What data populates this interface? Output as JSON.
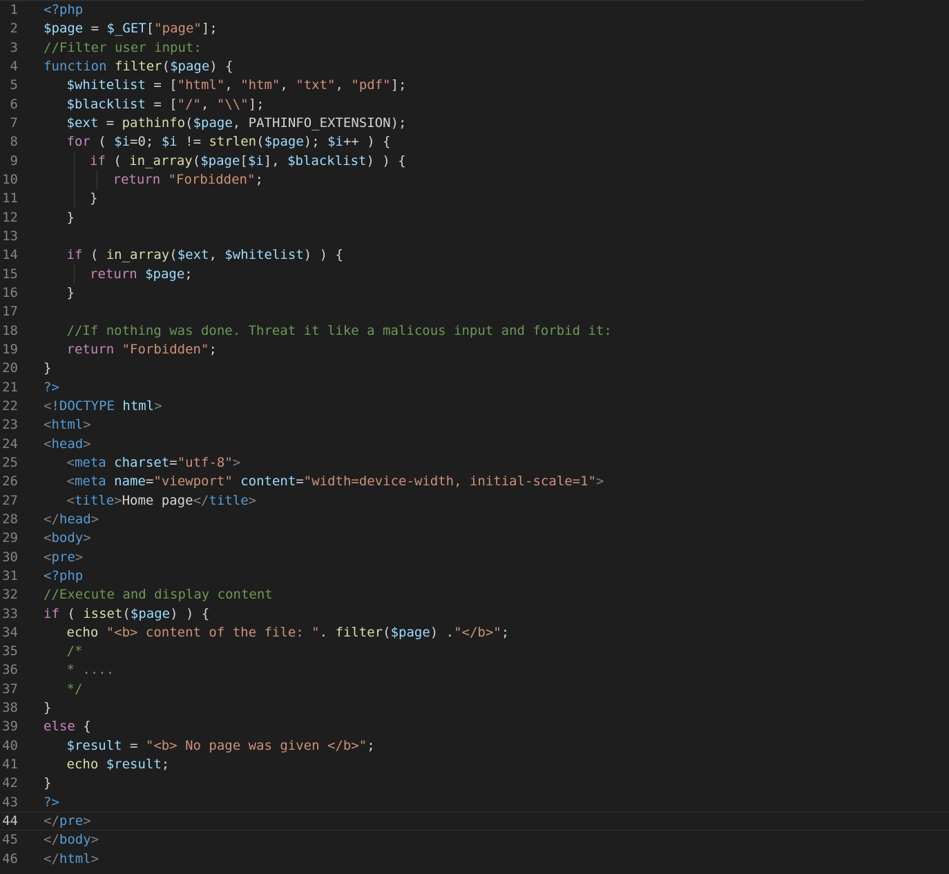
{
  "editor": {
    "theme_colors": {
      "background": "#1e1e1e",
      "keyword": "#569cd6",
      "control": "#c586c0",
      "variable": "#9cdcfe",
      "function": "#dcdcaa",
      "string": "#ce9178",
      "comment": "#6a9955",
      "tag_bracket": "#808080",
      "line_number": "#858585"
    },
    "current_line": 44,
    "lines": [
      {
        "n": "1",
        "indent": 0,
        "tokens": [
          [
            "t-kw",
            "<?php"
          ]
        ]
      },
      {
        "n": "2",
        "indent": 0,
        "tokens": [
          [
            "t-var",
            "$page"
          ],
          [
            "t-pun",
            " = "
          ],
          [
            "t-var",
            "$_GET"
          ],
          [
            "t-pun",
            "["
          ],
          [
            "t-str",
            "\"page\""
          ],
          [
            "t-pun",
            "];"
          ]
        ]
      },
      {
        "n": "3",
        "indent": 0,
        "tokens": [
          [
            "t-com",
            "//Filter user input:"
          ]
        ]
      },
      {
        "n": "4",
        "indent": 0,
        "tokens": [
          [
            "t-kw",
            "function"
          ],
          [
            "t-pun",
            " "
          ],
          [
            "t-fn",
            "filter"
          ],
          [
            "t-pun",
            "("
          ],
          [
            "t-var",
            "$page"
          ],
          [
            "t-pun",
            ") {"
          ]
        ]
      },
      {
        "n": "5",
        "indent": 1,
        "tokens": [
          [
            "t-var",
            "$whitelist"
          ],
          [
            "t-pun",
            " = ["
          ],
          [
            "t-str",
            "\"html\""
          ],
          [
            "t-pun",
            ", "
          ],
          [
            "t-str",
            "\"htm\""
          ],
          [
            "t-pun",
            ", "
          ],
          [
            "t-str",
            "\"txt\""
          ],
          [
            "t-pun",
            ", "
          ],
          [
            "t-str",
            "\"pdf\""
          ],
          [
            "t-pun",
            "];"
          ]
        ]
      },
      {
        "n": "6",
        "indent": 1,
        "tokens": [
          [
            "t-var",
            "$blacklist"
          ],
          [
            "t-pun",
            " = ["
          ],
          [
            "t-str",
            "\"/\""
          ],
          [
            "t-pun",
            ", "
          ],
          [
            "t-str",
            "\"\\\\\""
          ],
          [
            "t-pun",
            "];"
          ]
        ]
      },
      {
        "n": "7",
        "indent": 1,
        "tokens": [
          [
            "t-var",
            "$ext"
          ],
          [
            "t-pun",
            " = "
          ],
          [
            "t-fn",
            "pathinfo"
          ],
          [
            "t-pun",
            "("
          ],
          [
            "t-var",
            "$page"
          ],
          [
            "t-pun",
            ", "
          ],
          [
            "t-const",
            "PATHINFO_EXTENSION"
          ],
          [
            "t-pun",
            ");"
          ]
        ]
      },
      {
        "n": "8",
        "indent": 1,
        "tokens": [
          [
            "t-ctl",
            "for"
          ],
          [
            "t-pun",
            " ( "
          ],
          [
            "t-var",
            "$i"
          ],
          [
            "t-pun",
            "=0; "
          ],
          [
            "t-var",
            "$i"
          ],
          [
            "t-pun",
            " != "
          ],
          [
            "t-fn",
            "strlen"
          ],
          [
            "t-pun",
            "("
          ],
          [
            "t-var",
            "$page"
          ],
          [
            "t-pun",
            "); "
          ],
          [
            "t-var",
            "$i"
          ],
          [
            "t-pun",
            "++ ) {"
          ]
        ]
      },
      {
        "n": "9",
        "indent": 2,
        "tokens": [
          [
            "t-ctl",
            "if"
          ],
          [
            "t-pun",
            " ( "
          ],
          [
            "t-fn",
            "in_array"
          ],
          [
            "t-pun",
            "("
          ],
          [
            "t-var",
            "$page"
          ],
          [
            "t-pun",
            "["
          ],
          [
            "t-var",
            "$i"
          ],
          [
            "t-pun",
            "], "
          ],
          [
            "t-var",
            "$blacklist"
          ],
          [
            "t-pun",
            ") ) {"
          ]
        ]
      },
      {
        "n": "10",
        "indent": 3,
        "tokens": [
          [
            "t-ctl",
            "return"
          ],
          [
            "t-pun",
            " "
          ],
          [
            "t-str",
            "\"Forbidden\""
          ],
          [
            "t-pun",
            ";"
          ]
        ]
      },
      {
        "n": "11",
        "indent": 2,
        "tokens": [
          [
            "t-pun",
            "}"
          ]
        ]
      },
      {
        "n": "12",
        "indent": 1,
        "tokens": [
          [
            "t-pun",
            "}"
          ]
        ]
      },
      {
        "n": "13",
        "indent": 1,
        "tokens": []
      },
      {
        "n": "14",
        "indent": 1,
        "tokens": [
          [
            "t-ctl",
            "if"
          ],
          [
            "t-pun",
            " ( "
          ],
          [
            "t-fn",
            "in_array"
          ],
          [
            "t-pun",
            "("
          ],
          [
            "t-var",
            "$ext"
          ],
          [
            "t-pun",
            ", "
          ],
          [
            "t-var",
            "$whitelist"
          ],
          [
            "t-pun",
            ") ) {"
          ]
        ]
      },
      {
        "n": "15",
        "indent": 2,
        "tokens": [
          [
            "t-ctl",
            "return"
          ],
          [
            "t-pun",
            " "
          ],
          [
            "t-var",
            "$page"
          ],
          [
            "t-pun",
            ";"
          ]
        ]
      },
      {
        "n": "16",
        "indent": 1,
        "tokens": [
          [
            "t-pun",
            "}"
          ]
        ]
      },
      {
        "n": "17",
        "indent": 1,
        "tokens": []
      },
      {
        "n": "18",
        "indent": 1,
        "tokens": [
          [
            "t-com",
            "//If nothing was done. Threat it like a malicous input and forbid it:"
          ]
        ]
      },
      {
        "n": "19",
        "indent": 1,
        "tokens": [
          [
            "t-ctl",
            "return"
          ],
          [
            "t-pun",
            " "
          ],
          [
            "t-str",
            "\"Forbidden\""
          ],
          [
            "t-pun",
            ";"
          ]
        ]
      },
      {
        "n": "20",
        "indent": 0,
        "tokens": [
          [
            "t-pun",
            "}"
          ]
        ]
      },
      {
        "n": "21",
        "indent": 0,
        "tokens": [
          [
            "t-kw",
            "?>"
          ]
        ]
      },
      {
        "n": "22",
        "indent": 0,
        "tokens": [
          [
            "t-br",
            "<"
          ],
          [
            "t-tag",
            "!DOCTYPE"
          ],
          [
            "t-pun",
            " "
          ],
          [
            "t-attr",
            "html"
          ],
          [
            "t-br",
            ">"
          ]
        ]
      },
      {
        "n": "23",
        "indent": 0,
        "tokens": [
          [
            "t-br",
            "<"
          ],
          [
            "t-tag",
            "html"
          ],
          [
            "t-br",
            ">"
          ]
        ]
      },
      {
        "n": "24",
        "indent": 0,
        "tokens": [
          [
            "t-br",
            "<"
          ],
          [
            "t-tag",
            "head"
          ],
          [
            "t-br",
            ">"
          ]
        ]
      },
      {
        "n": "25",
        "indent": 1,
        "tokens": [
          [
            "t-br",
            "<"
          ],
          [
            "t-tag",
            "meta"
          ],
          [
            "t-pun",
            " "
          ],
          [
            "t-attr",
            "charset"
          ],
          [
            "t-pun",
            "="
          ],
          [
            "t-str",
            "\"utf-8\""
          ],
          [
            "t-br",
            ">"
          ]
        ]
      },
      {
        "n": "26",
        "indent": 1,
        "tokens": [
          [
            "t-br",
            "<"
          ],
          [
            "t-tag",
            "meta"
          ],
          [
            "t-pun",
            " "
          ],
          [
            "t-attr",
            "name"
          ],
          [
            "t-pun",
            "="
          ],
          [
            "t-str",
            "\"viewport\""
          ],
          [
            "t-pun",
            " "
          ],
          [
            "t-attr",
            "content"
          ],
          [
            "t-pun",
            "="
          ],
          [
            "t-str",
            "\"width=device-width, initial-scale=1\""
          ],
          [
            "t-br",
            ">"
          ]
        ]
      },
      {
        "n": "27",
        "indent": 1,
        "tokens": [
          [
            "t-br",
            "<"
          ],
          [
            "t-tag",
            "title"
          ],
          [
            "t-br",
            ">"
          ],
          [
            "t-txt",
            "Home page"
          ],
          [
            "t-br",
            "</"
          ],
          [
            "t-tag",
            "title"
          ],
          [
            "t-br",
            ">"
          ]
        ]
      },
      {
        "n": "28",
        "indent": 0,
        "tokens": [
          [
            "t-br",
            "</"
          ],
          [
            "t-tag",
            "head"
          ],
          [
            "t-br",
            ">"
          ]
        ]
      },
      {
        "n": "29",
        "indent": 0,
        "tokens": [
          [
            "t-br",
            "<"
          ],
          [
            "t-tag",
            "body"
          ],
          [
            "t-br",
            ">"
          ]
        ]
      },
      {
        "n": "30",
        "indent": 0,
        "tokens": [
          [
            "t-br",
            "<"
          ],
          [
            "t-tag",
            "pre"
          ],
          [
            "t-br",
            ">"
          ]
        ]
      },
      {
        "n": "31",
        "indent": 0,
        "tokens": [
          [
            "t-kw",
            "<?php"
          ]
        ]
      },
      {
        "n": "32",
        "indent": 0,
        "tokens": [
          [
            "t-com",
            "//Execute and display content"
          ]
        ]
      },
      {
        "n": "33",
        "indent": 0,
        "tokens": [
          [
            "t-ctl",
            "if"
          ],
          [
            "t-pun",
            " ( "
          ],
          [
            "t-fn",
            "isset"
          ],
          [
            "t-pun",
            "("
          ],
          [
            "t-var",
            "$page"
          ],
          [
            "t-pun",
            ") ) {"
          ]
        ]
      },
      {
        "n": "34",
        "indent": 1,
        "tokens": [
          [
            "t-fn",
            "echo"
          ],
          [
            "t-pun",
            " "
          ],
          [
            "t-str",
            "\"<b> content of the file: \""
          ],
          [
            "t-pun",
            ". "
          ],
          [
            "t-fn",
            "filter"
          ],
          [
            "t-pun",
            "("
          ],
          [
            "t-var",
            "$page"
          ],
          [
            "t-pun",
            ") ."
          ],
          [
            "t-str",
            "\"</b>\""
          ],
          [
            "t-pun",
            ";"
          ]
        ]
      },
      {
        "n": "35",
        "indent": 1,
        "tokens": [
          [
            "t-com",
            "/*"
          ]
        ]
      },
      {
        "n": "36",
        "indent": 1,
        "tokens": [
          [
            "t-com",
            "* ...."
          ]
        ]
      },
      {
        "n": "37",
        "indent": 1,
        "tokens": [
          [
            "t-com",
            "*/"
          ]
        ]
      },
      {
        "n": "38",
        "indent": 0,
        "tokens": [
          [
            "t-pun",
            "}"
          ]
        ]
      },
      {
        "n": "39",
        "indent": 0,
        "tokens": [
          [
            "t-ctl",
            "else"
          ],
          [
            "t-pun",
            " {"
          ]
        ]
      },
      {
        "n": "40",
        "indent": 1,
        "tokens": [
          [
            "t-var",
            "$result"
          ],
          [
            "t-pun",
            " = "
          ],
          [
            "t-str",
            "\"<b> No page was given </b>\""
          ],
          [
            "t-pun",
            ";"
          ]
        ]
      },
      {
        "n": "41",
        "indent": 1,
        "tokens": [
          [
            "t-fn",
            "echo"
          ],
          [
            "t-pun",
            " "
          ],
          [
            "t-var",
            "$result"
          ],
          [
            "t-pun",
            ";"
          ]
        ]
      },
      {
        "n": "42",
        "indent": 0,
        "tokens": [
          [
            "t-pun",
            "}"
          ]
        ]
      },
      {
        "n": "43",
        "indent": 0,
        "tokens": [
          [
            "t-kw",
            "?>"
          ]
        ]
      },
      {
        "n": "44",
        "indent": 0,
        "tokens": [
          [
            "t-br",
            "</"
          ],
          [
            "t-tag",
            "pre"
          ],
          [
            "t-br",
            ">"
          ]
        ]
      },
      {
        "n": "45",
        "indent": 0,
        "tokens": [
          [
            "t-br",
            "</"
          ],
          [
            "t-tag",
            "body"
          ],
          [
            "t-br",
            ">"
          ]
        ]
      },
      {
        "n": "46",
        "indent": 0,
        "tokens": [
          [
            "t-br",
            "</"
          ],
          [
            "t-tag",
            "html"
          ],
          [
            "t-br",
            ">"
          ]
        ]
      }
    ]
  }
}
